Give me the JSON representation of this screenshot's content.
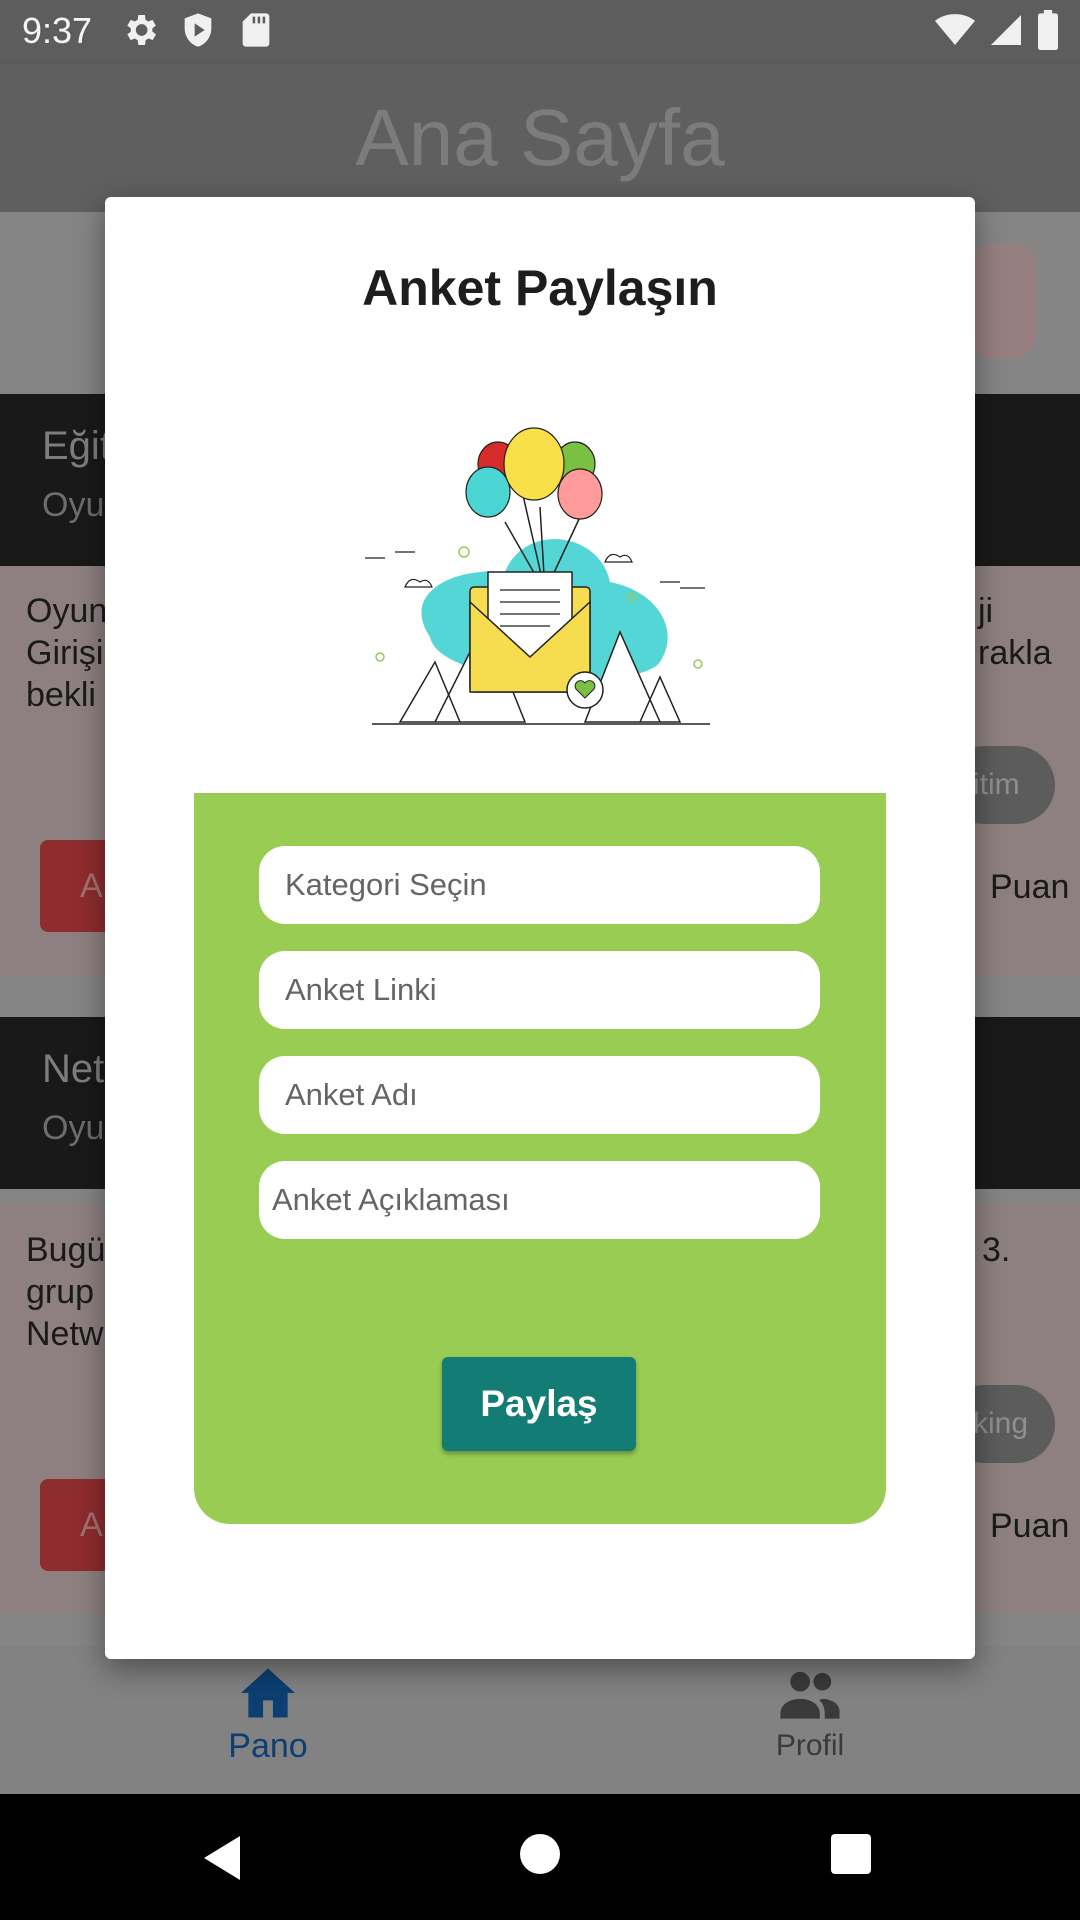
{
  "status_bar": {
    "time": "9:37",
    "icons_left": [
      "gear-icon",
      "shield-icon",
      "sd-card-icon"
    ],
    "icons_right": [
      "wifi-icon",
      "signal-icon",
      "battery-icon"
    ]
  },
  "app_bar": {
    "title": "Ana Sayfa"
  },
  "background_cards": [
    {
      "title": "Eğit",
      "subtitle": "Oyu",
      "desc_left": "Oyun\nGirişi\nbekli",
      "desc_right": "ji\nrakla",
      "tag": "itim",
      "button": "A",
      "puan": "Puan"
    },
    {
      "title": "Net",
      "subtitle": "Oyu",
      "desc_left": "Bugü\ngrup\nNetw",
      "desc_right": "3.",
      "tag": "king",
      "button": "A",
      "puan": "Puan"
    }
  ],
  "bottom_nav": {
    "items": [
      {
        "label": "Pano",
        "icon": "home-icon",
        "active": true
      },
      {
        "label": "Profil",
        "icon": "people-icon",
        "active": false
      }
    ]
  },
  "dialog": {
    "title": "Anket Paylaşın",
    "illustration": "envelope-balloons-illustration",
    "fields": {
      "category": {
        "placeholder": "Kategori Seçin",
        "value": ""
      },
      "link": {
        "placeholder": "Anket Linki",
        "value": ""
      },
      "name": {
        "placeholder": "Anket Adı",
        "value": ""
      },
      "description": {
        "placeholder": "Anket Açıklaması",
        "value": ""
      }
    },
    "share_button": "Paylaş"
  },
  "colors": {
    "panel_green": "#99cc52",
    "button_teal": "#127c75",
    "nav_active": "#0d3f72"
  }
}
